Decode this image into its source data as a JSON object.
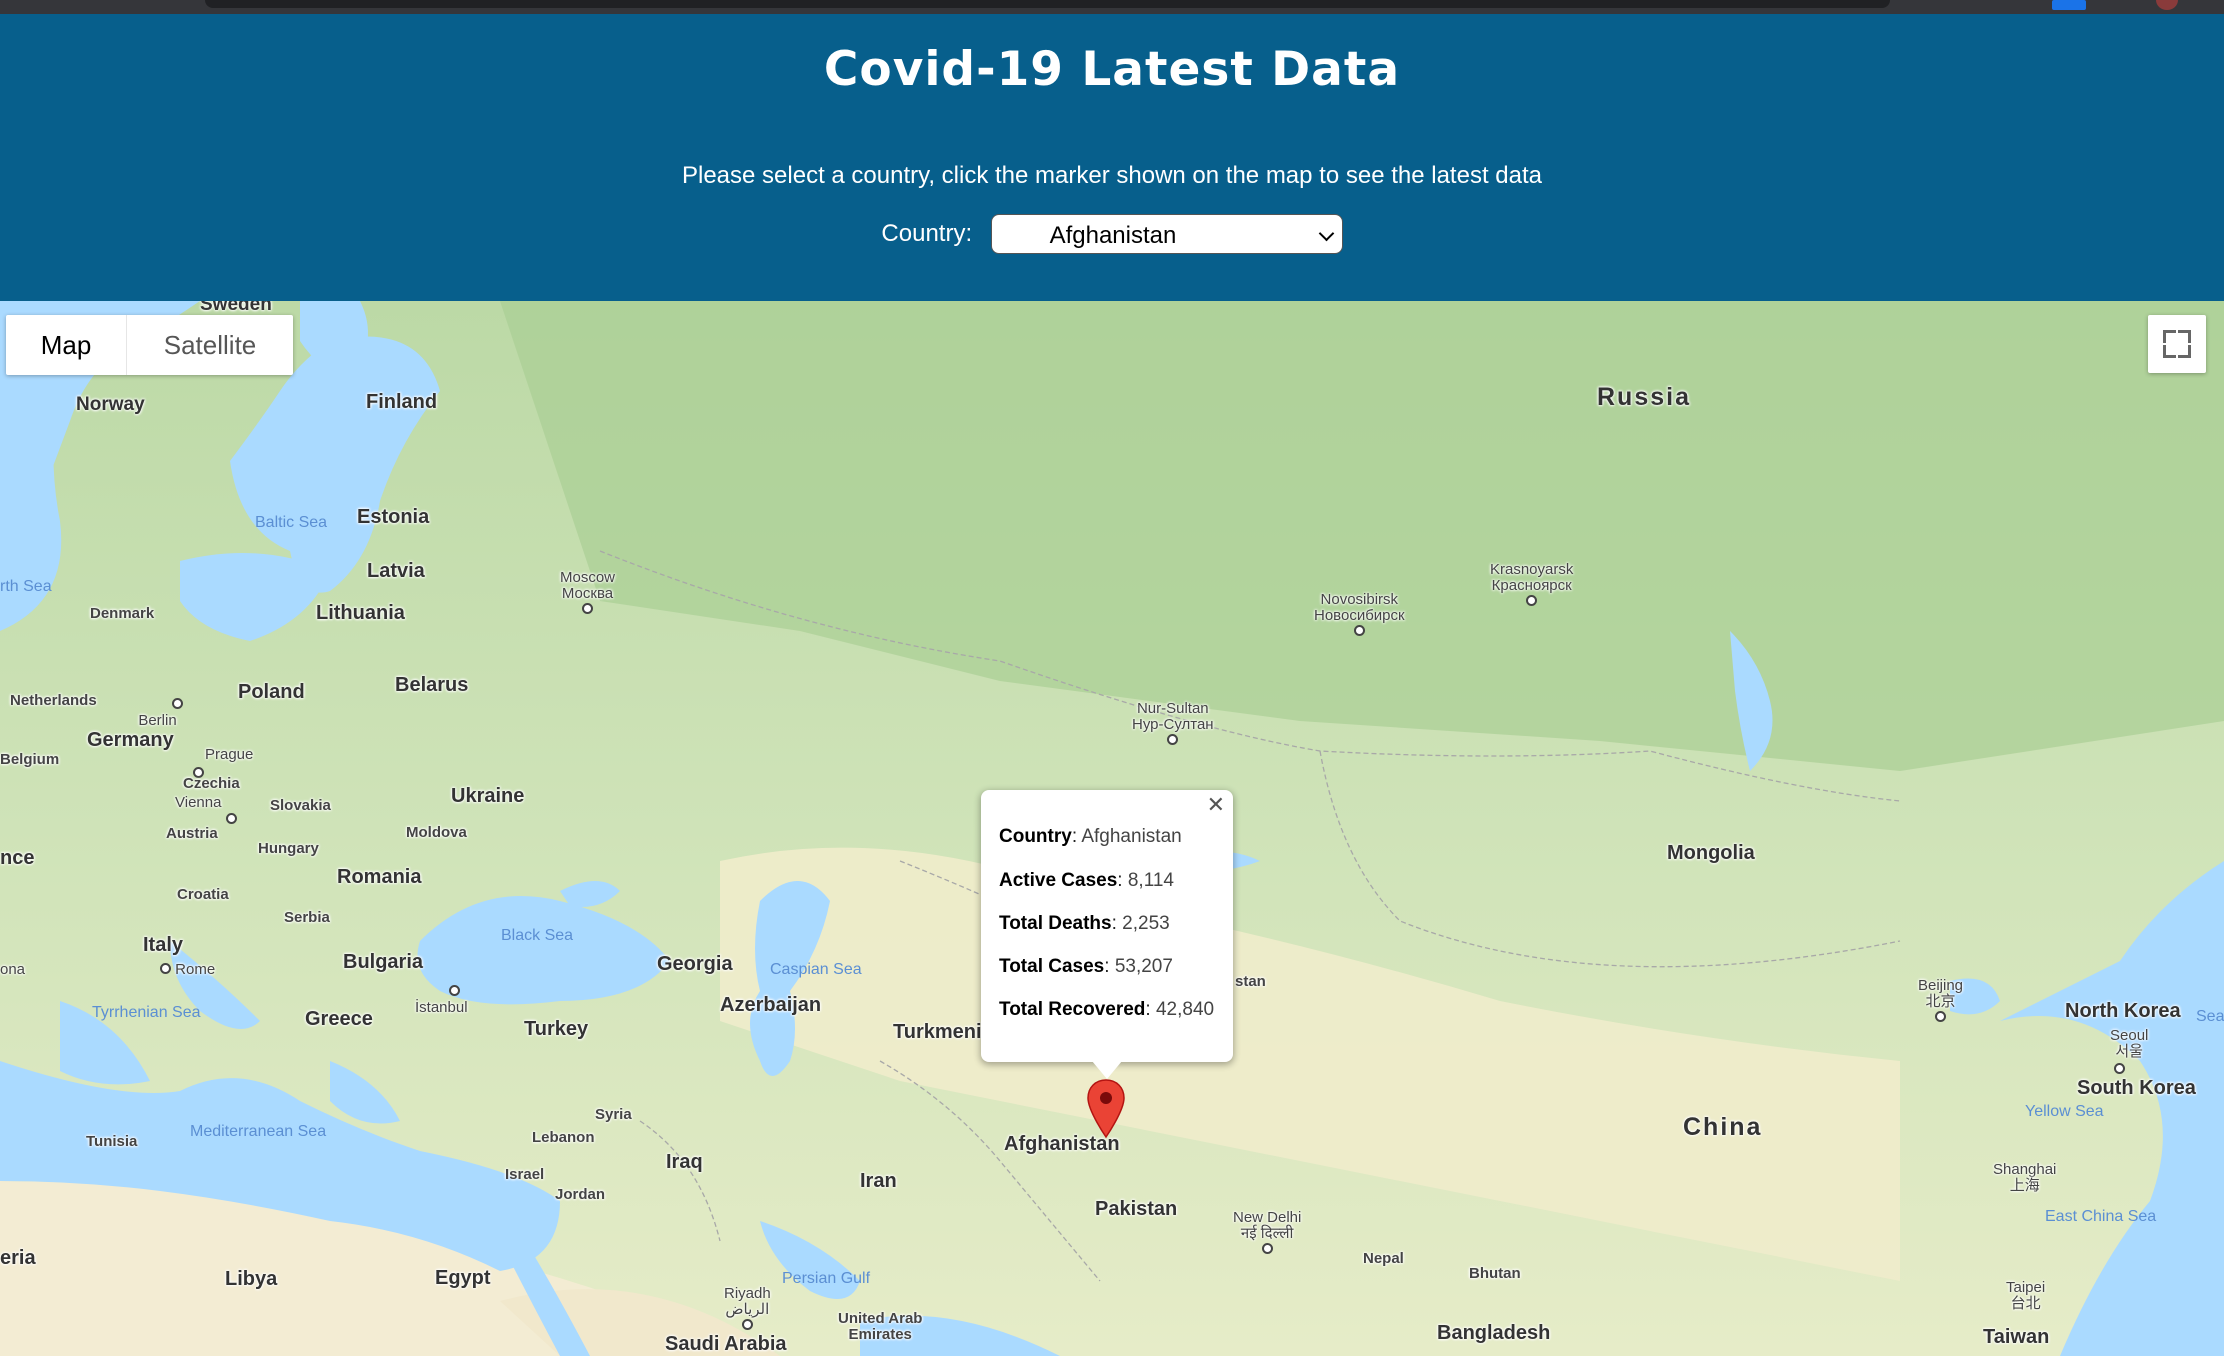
{
  "header": {
    "title": "Covid-19 Latest Data",
    "instructions": "Please select a country, click the marker shown on the map to see the latest data",
    "country_label": "Country:",
    "country_selected": "Afghanistan"
  },
  "map_controls": {
    "map_label": "Map",
    "satellite_label": "Satellite",
    "fullscreen_icon": "fullscreen-icon",
    "active_type": "Map"
  },
  "info_window": {
    "country_label": "Country",
    "country_value": "Afghanistan",
    "active_label": "Active Cases",
    "active_value": "8,114",
    "deaths_label": "Total Deaths",
    "deaths_value": "2,253",
    "cases_label": "Total Cases",
    "cases_value": "53,207",
    "recovered_label": "Total Recovered",
    "recovered_value": "42,840"
  },
  "map_labels": {
    "sweden": "Sweden",
    "norway": "Norway",
    "finland": "Finland",
    "russia": "Russia",
    "estonia": "Estonia",
    "latvia": "Latvia",
    "lithuania": "Lithuania",
    "denmark": "Denmark",
    "baltic_sea": "Baltic Sea",
    "north_sea": "rth Sea",
    "moscow": "Moscow",
    "moscow_ru": "Москва",
    "novosibirsk": "Novosibirsk",
    "novosibirsk_ru": "Новосибирск",
    "krasnoyarsk": "Krasnoyarsk",
    "krasnoyarsk_ru": "Красноярск",
    "netherlands": "Netherlands",
    "berlin": "Berlin",
    "poland": "Poland",
    "belarus": "Belarus",
    "germany": "Germany",
    "belgium": "Belgium",
    "prague": "Prague",
    "czechia": "Czechia",
    "vienna": "Vienna",
    "slovakia": "Slovakia",
    "ukraine": "Ukraine",
    "austria": "Austria",
    "moldova": "Moldova",
    "hungary": "Hungary",
    "romania": "Romania",
    "croatia": "Croatia",
    "serbia": "Serbia",
    "france_partial": "nce",
    "italy": "Italy",
    "rome": "Rome",
    "bulgaria": "Bulgaria",
    "istanbul": "İstanbul",
    "tyrrhenian_sea": "Tyrrhenian Sea",
    "greece": "Greece",
    "turkey": "Turkey",
    "black_sea": "Black Sea",
    "georgia": "Georgia",
    "caspian_sea": "Caspian Sea",
    "azerbaijan": "Azerbaijan",
    "turkmeni": "Turkmeni",
    "nur_sultan": "Nur-Sultan",
    "nur_sultan_ru": "Нур-Султан",
    "mongolia": "Mongolia",
    "stan_partial": "stan",
    "beijing": "Beijing",
    "beijing_zh": "北京",
    "north_korea": "North Korea",
    "sea_partial": "Sea",
    "seoul": "Seoul",
    "seoul_ko": "서울",
    "south_korea": "South Korea",
    "yellow_sea": "Yellow Sea",
    "china": "China",
    "shanghai": "Shanghai",
    "shanghai_zh": "上海",
    "east_china_sea": "East China Sea",
    "tunisia": "Tunisia",
    "mediterranean_sea": "Mediterranean Sea",
    "syria": "Syria",
    "lebanon": "Lebanon",
    "iraq": "Iraq",
    "iran": "Iran",
    "afghanistan": "Afghanistan",
    "israel": "Israel",
    "jordan": "Jordan",
    "pakistan": "Pakistan",
    "new_delhi": "New Delhi",
    "new_delhi_hi": "नई दिल्ली",
    "nepal": "Nepal",
    "bhutan": "Bhutan",
    "algeria_partial": "eria",
    "libya": "Libya",
    "egypt": "Egypt",
    "persian_gulf": "Persian Gulf",
    "riyadh": "Riyadh",
    "riyadh_ar": "الرياض",
    "uae_1": "United Arab",
    "uae_2": "Emirates",
    "saudi_arabia": "Saudi Arabia",
    "bangladesh": "Bangladesh",
    "taipei": "Taipei",
    "taipei_zh": "台北",
    "taiwan": "Taiwan",
    "roma_partial": "ona"
  },
  "colors": {
    "header_bg": "#075f8c",
    "land_green": "#cfe3b8",
    "land_sand": "#f1ecd5",
    "water": "#aadaff",
    "marker_red": "#ea4335"
  }
}
